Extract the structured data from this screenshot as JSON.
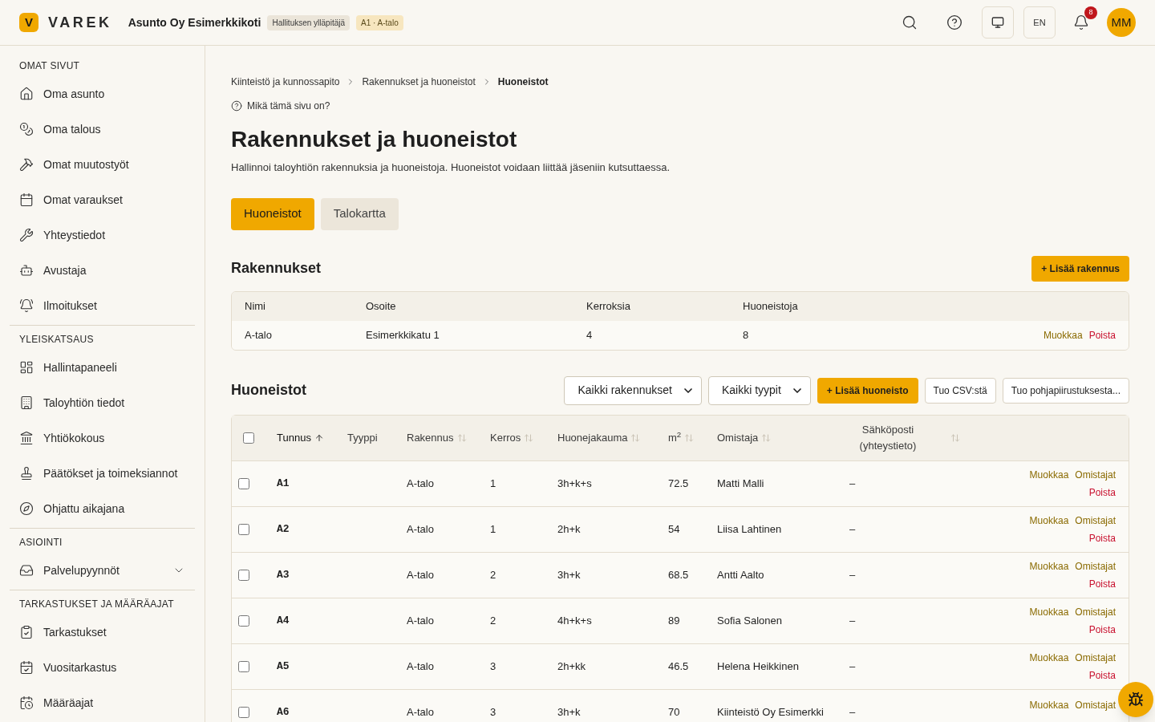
{
  "header": {
    "logo_letter": "V",
    "brand": "VAREK",
    "organization": "Asunto Oy Esimerkkikoti",
    "badges": [
      {
        "label": "Hallituksen ylläpitäjä",
        "kind": "role"
      },
      {
        "label": "A1 · A-talo",
        "kind": "unit"
      }
    ],
    "language": "EN",
    "notification_count": "8",
    "avatar": "MM"
  },
  "sidebar": {
    "sections": [
      {
        "title": "OMAT SIVUT",
        "items": [
          {
            "label": "Oma asunto"
          },
          {
            "label": "Oma talous"
          },
          {
            "label": "Omat muutostyöt"
          },
          {
            "label": "Omat varaukset"
          },
          {
            "label": "Yhteystiedot"
          },
          {
            "label": "Avustaja"
          },
          {
            "label": "Ilmoitukset"
          }
        ]
      },
      {
        "title": "YLEISKATSAUS",
        "items": [
          {
            "label": "Hallintapaneeli"
          },
          {
            "label": "Taloyhtiön tiedot"
          },
          {
            "label": "Yhtiökokous"
          },
          {
            "label": "Päätökset ja toimeksiannot"
          },
          {
            "label": "Ohjattu aikajana"
          }
        ]
      },
      {
        "title": "ASIOINTI",
        "items": [
          {
            "label": "Palvelupyynnöt",
            "expanded": false
          }
        ]
      },
      {
        "title": "TARKASTUKSET JA MÄÄRÄAJAT",
        "items": [
          {
            "label": "Tarkastukset"
          },
          {
            "label": "Vuositarkastus"
          },
          {
            "label": "Määräajat"
          }
        ]
      }
    ]
  },
  "breadcrumbs": [
    "Kiinteistö ja kunnossapito",
    "Rakennukset ja huoneistot",
    "Huoneistot"
  ],
  "help_link": "Mikä tämä sivu on?",
  "title": "Rakennukset ja huoneistot",
  "description": "Hallinnoi taloyhtiön rakennuksia ja huoneistoja. Huoneistot voidaan liittää jäseniin kutsuttaessa.",
  "tabs": [
    {
      "label": "Huoneistot",
      "selected": true
    },
    {
      "label": "Talokartta",
      "selected": false
    }
  ],
  "buildings": {
    "title": "Rakennukset",
    "add_button": "+ Lisää rakennus",
    "columns": [
      "Nimi",
      "Osoite",
      "Kerroksia",
      "Huoneistoja"
    ],
    "rows": [
      {
        "cells": [
          "A-talo",
          "Esimerkkikatu 1",
          "4",
          "8"
        ],
        "edit": "Muokkaa",
        "delete": "Poista"
      }
    ]
  },
  "apartments": {
    "title": "Huoneistot",
    "filters": [
      {
        "value": "Kaikki rakennukset"
      },
      {
        "value": "Kaikki tyypit"
      }
    ],
    "add_button": "+ Lisää huoneisto",
    "import_buttons": [
      "Tuo CSV:stä",
      "Tuo pohjapiirustuksesta..."
    ],
    "select_all_checked": false,
    "columns": [
      {
        "label": "Tunnus",
        "sortable": true,
        "sorted": true
      },
      {
        "label": "Tyyppi",
        "sortable": false,
        "sorted": false
      },
      {
        "label": "Rakennus",
        "sortable": true,
        "sorted": false
      },
      {
        "label": "Kerros",
        "sortable": true,
        "sorted": false
      },
      {
        "label": "Huonejakauma",
        "sortable": true,
        "sorted": false
      },
      {
        "label": "m$^{2}$",
        "sortable": true,
        "sorted": false
      },
      {
        "label": "Omistaja",
        "sortable": true,
        "sorted": false
      },
      {
        "label": "Sähköposti (yhteystieto)",
        "sortable": true,
        "sorted": false
      }
    ],
    "rows": [
      {
        "checked": false,
        "cells": [
          "A1",
          "",
          "A-talo",
          "1",
          "3h+k+s",
          "72.5",
          "Matti Malli",
          "–"
        ],
        "actions": [
          "Muokkaa",
          "Omistajat",
          "Poista"
        ]
      },
      {
        "checked": false,
        "cells": [
          "A2",
          "",
          "A-talo",
          "1",
          "2h+k",
          "54",
          "Liisa Lahtinen",
          "–"
        ],
        "actions": [
          "Muokkaa",
          "Omistajat",
          "Poista"
        ]
      },
      {
        "checked": false,
        "cells": [
          "A3",
          "",
          "A-talo",
          "2",
          "3h+k",
          "68.5",
          "Antti Aalto",
          "–"
        ],
        "actions": [
          "Muokkaa",
          "Omistajat",
          "Poista"
        ]
      },
      {
        "checked": false,
        "cells": [
          "A4",
          "",
          "A-talo",
          "2",
          "4h+k+s",
          "89",
          "Sofia Salonen",
          "–"
        ],
        "actions": [
          "Muokkaa",
          "Omistajat",
          "Poista"
        ]
      },
      {
        "checked": false,
        "cells": [
          "A5",
          "",
          "A-talo",
          "3",
          "2h+kk",
          "46.5",
          "Helena Heikkinen",
          "–"
        ],
        "actions": [
          "Muokkaa",
          "Omistajat",
          "Poista"
        ]
      },
      {
        "checked": false,
        "cells": [
          "A6",
          "",
          "A-talo",
          "3",
          "3h+k",
          "70",
          "Kiinteistö Oy Esimerkki",
          "–"
        ],
        "actions": [
          "Muokkaa",
          "Omistajat"
        ]
      }
    ]
  }
}
